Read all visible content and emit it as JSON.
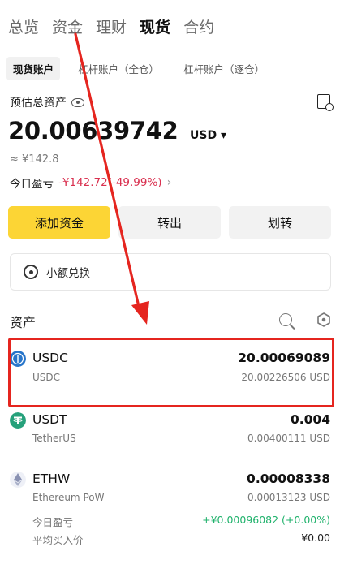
{
  "nav": {
    "tabs": [
      "总览",
      "资金",
      "理财",
      "现货",
      "合约"
    ],
    "active_index": 3
  },
  "subtabs": [
    "现货账户",
    "杠杆账户（全仓）",
    "杠杆账户（逐仓）"
  ],
  "summary": {
    "label": "预估总资产",
    "balance": "20.00639742",
    "currency": "USD ▾",
    "approx": "≈ ¥142.8",
    "pnl_label": "今日盈亏",
    "pnl_value": "-¥142.72(-49.99%)",
    "pnl_chevron": "›"
  },
  "actions": {
    "deposit": "添加资金",
    "transfer_out": "转出",
    "transfer": "划转"
  },
  "small_convert": "小额兑换",
  "assets": {
    "title": "资产",
    "items": [
      {
        "symbol": "USDC",
        "name": "USDC",
        "amount": "20.00069089",
        "usd": "20.00226506 USD",
        "color": "#2775ca"
      },
      {
        "symbol": "USDT",
        "name": "TetherUS",
        "amount": "0.004",
        "usd": "0.00400111 USD",
        "color": "#26a17b"
      },
      {
        "symbol": "ETHW",
        "name": "Ethereum PoW",
        "amount": "0.00008338",
        "usd": "0.00013123 USD",
        "color": "#8a92b2",
        "today_pnl_label": "今日盈亏",
        "today_pnl": "+¥0.00096082 (+0.00%)",
        "avg_price_label": "平均买入价",
        "avg_price": "¥0.00"
      }
    ]
  },
  "colors": {
    "accent": "#fcd535",
    "negative": "#d9304f",
    "positive": "#20b26c",
    "highlight": "#e5251f"
  }
}
